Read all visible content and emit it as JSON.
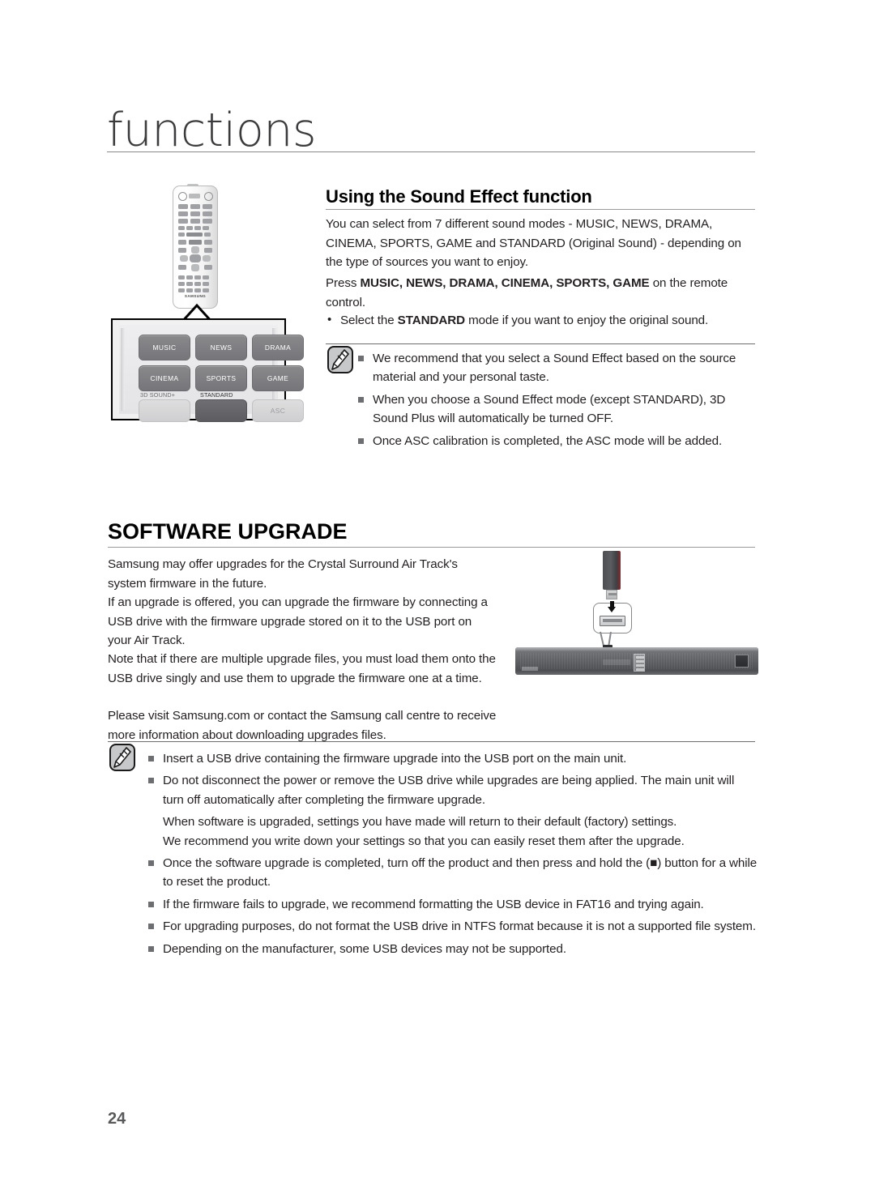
{
  "chapter": {
    "title": "functions"
  },
  "sound_effect": {
    "heading": "Using the Sound Effect function",
    "paragraph_modes": "You can select from 7 different sound modes - MUSIC, NEWS, DRAMA, CINEMA, SPORTS, GAME and STANDARD (Original Sound) - depending on the type of sources you want to enjoy.",
    "press_prefix": "Press ",
    "press_bold": "MUSIC, NEWS, DRAMA, CINEMA, SPORTS, GAME",
    "press_suffix": " on the remote control.",
    "bullet_prefix": "Select the ",
    "bullet_bold": "STANDARD",
    "bullet_suffix": " mode if you want to enjoy the original sound.",
    "notes": [
      "We recommend that you select a Sound Effect based on the source material and your personal taste.",
      "When you choose a Sound Effect mode (except STANDARD), 3D Sound Plus will automatically be turned OFF.",
      "Once ASC calibration is completed, the ASC mode will be added."
    ]
  },
  "remote_illustration": {
    "brand": "SAMSUNG",
    "buttons": [
      "MUSIC",
      "NEWS",
      "DRAMA",
      "CINEMA",
      "SPORTS",
      "GAME"
    ],
    "bottom_row": {
      "label_3d": "3D SOUND+",
      "label_standard": "STANDARD",
      "asc": "ASC"
    }
  },
  "software_upgrade": {
    "heading": "SOFTWARE UPGRADE",
    "paragraphs": [
      "Samsung may offer upgrades for the Crystal Surround Air Track's system firmware in the future.",
      "If an upgrade is offered, you can upgrade the firmware by connecting a USB drive with the firmware upgrade stored on it to the USB port on your Air Track.",
      "Note that if there are multiple upgrade files, you must load them onto the USB drive singly and use them to upgrade the firmware one at a time.",
      "Please visit Samsung.com or contact the Samsung call centre to receive more information about downloading upgrades files."
    ],
    "notes": [
      "Insert a USB drive containing the firmware upgrade into the USB port on the main unit.",
      "Do not disconnect the power or remove the USB drive while upgrades are being applied. The main unit will turn off automatically after completing the firmware upgrade.",
      "Once the software upgrade is completed, turn off the product and then press and hold the (■) button for a while to reset the product.",
      "If the firmware fails to upgrade, we recommend formatting the USB device in FAT16 and trying again.",
      "For upgrading purposes, do not format the USB drive in NTFS format because it is not a supported file system.",
      "Depending on the manufacturer, some USB devices may not be supported."
    ],
    "note2_sub_lines": [
      "When software is upgraded, settings you have made will return to their default (factory) settings.",
      "We recommend you write down your settings so that you can easily reset them after the upgrade."
    ]
  },
  "footer": {
    "page_number": "24"
  },
  "colors": {
    "text": "#231f20",
    "rule": "#9a9a9d",
    "note_icon_fill": "#c7c8ca",
    "page_number": "#58595b"
  }
}
